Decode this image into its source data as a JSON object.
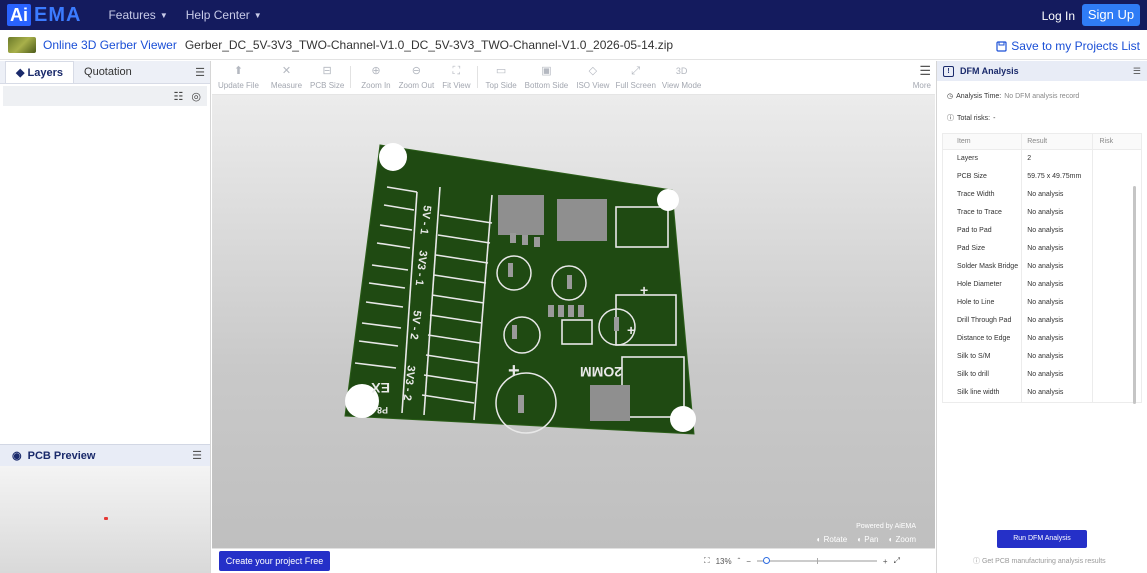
{
  "header": {
    "logo_ai": "Ai",
    "logo_ema": "EMA",
    "nav": [
      {
        "label": "Features"
      },
      {
        "label": "Help Center"
      }
    ],
    "login": "Log In",
    "signup": "Sign Up"
  },
  "subheader": {
    "viewer_title": "Online 3D Gerber Viewer",
    "filename": "Gerber_DC_5V-3V3_TWO-Channel-V1.0_DC_5V-3V3_TWO-Channel-V1.0_2026-05-14.zip",
    "save_label": "Save to my Projects List"
  },
  "left_panel": {
    "tabs": [
      {
        "label": "Layers"
      },
      {
        "label": "Quotation"
      }
    ],
    "preview_title": "PCB Preview"
  },
  "toolbar": {
    "tools": [
      {
        "label": "Update File"
      },
      {
        "label": "Measure"
      },
      {
        "label": "PCB Size"
      },
      {
        "label": "Zoom In"
      },
      {
        "label": "Zoom Out"
      },
      {
        "label": "Fit View"
      },
      {
        "label": "Top Side"
      },
      {
        "label": "Bottom Side"
      },
      {
        "label": "ISO View"
      },
      {
        "label": "Full Screen"
      },
      {
        "label": "View Mode",
        "icon_text": "3D"
      }
    ],
    "more": "More"
  },
  "canvas": {
    "powered": "Powered by AiEMA",
    "controls": [
      "Rotate",
      "Pan",
      "Zoom"
    ],
    "pcb_labels": {
      "reg": "2OMM",
      "ex": "EX",
      "p8": "P8",
      "v1": "5V - 1",
      "v2": "5V - 2",
      "v3a": "3V3 - 1",
      "v3b": "3V3 - 2"
    }
  },
  "bottom": {
    "create": "Create your project Free",
    "zoom": "13%"
  },
  "dfm": {
    "title": "DFM Analysis",
    "analysis_time_label": "Analysis Time:",
    "analysis_time_value": "No DFM analysis record",
    "total_risks_label": "Total risks:",
    "total_risks_value": "-",
    "columns": [
      "Item",
      "Result",
      "Risk"
    ],
    "rows": [
      {
        "item": "Layers",
        "result": "2"
      },
      {
        "item": "PCB Size",
        "result": "59.75 x 49.75mm"
      },
      {
        "item": "Trace Width",
        "result": "No analysis"
      },
      {
        "item": "Trace to Trace",
        "result": "No analysis"
      },
      {
        "item": "Pad to Pad",
        "result": "No analysis"
      },
      {
        "item": "Pad Size",
        "result": "No analysis"
      },
      {
        "item": "Solder Mask Bridge",
        "result": "No analysis"
      },
      {
        "item": "Hole Diameter",
        "result": "No analysis"
      },
      {
        "item": "Hole to Line",
        "result": "No analysis"
      },
      {
        "item": "Drill Through Pad",
        "result": "No analysis"
      },
      {
        "item": "Distance to Edge",
        "result": "No analysis"
      },
      {
        "item": "Silk to S/M",
        "result": "No analysis"
      },
      {
        "item": "Silk to drill",
        "result": "No analysis"
      },
      {
        "item": "Silk line width",
        "result": "No analysis"
      }
    ],
    "run_button": "Run DFM Analysis",
    "get_results": "Get PCB manufacturing analysis results"
  },
  "colors": {
    "nav_bg": "#141b5e",
    "accent": "#2f7cf6",
    "primary_button": "#2530c8",
    "pcb_green": "#1f4a12"
  }
}
